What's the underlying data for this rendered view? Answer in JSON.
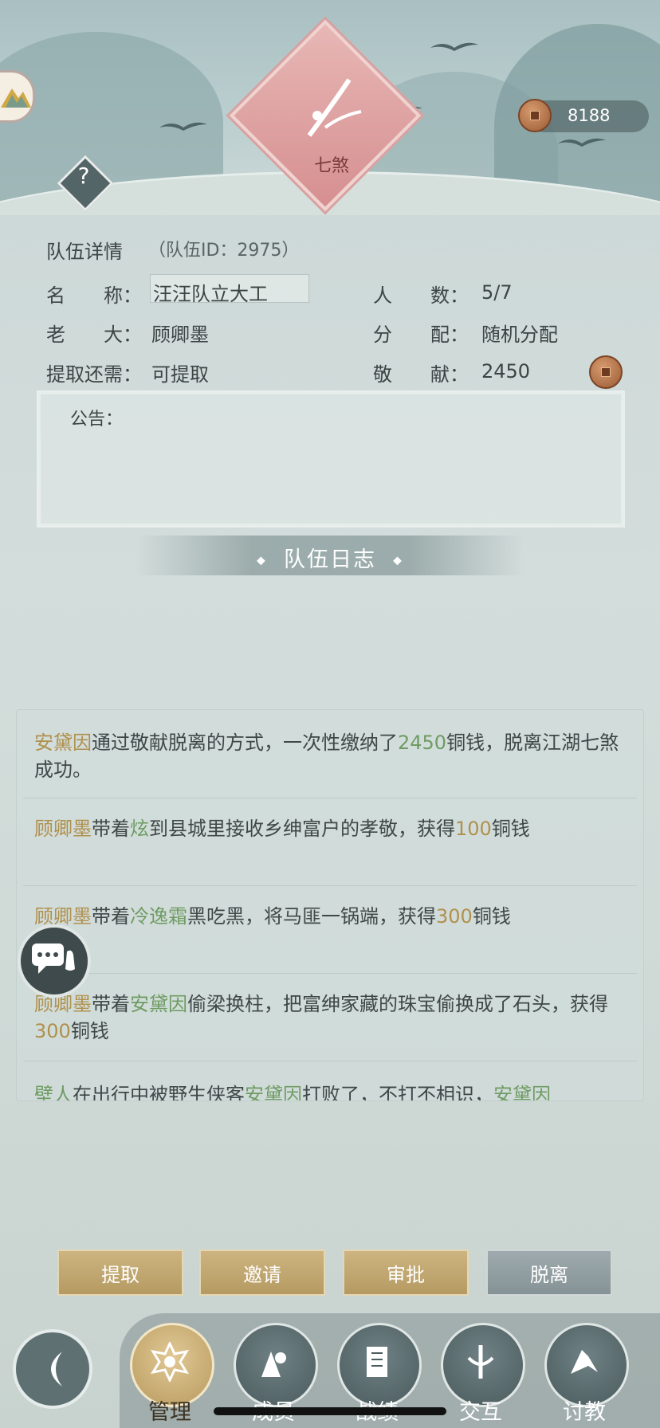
{
  "header": {
    "emblem_text": "七煞",
    "coins": "8188"
  },
  "team": {
    "title": "队伍详情",
    "id_label": "（队伍ID：2975）",
    "name_label": "名　　称：",
    "name_value": "汪汪队立大工",
    "members_label": "人　　数：",
    "members_value": "5/7",
    "leader_label": "老　　大：",
    "leader_value": "顾卿墨",
    "distribution_label": "分　　配：",
    "distribution_value": "随机分配",
    "withdraw_label": "提取还需：",
    "withdraw_value": "可提取",
    "contribution_label": "敬　　献：",
    "contribution_value": "2450",
    "notice_label": "公告："
  },
  "log": {
    "title": "队伍日志",
    "entries": [
      {
        "a": "安黛因",
        "b": "通过敬献脱离的方式，一次性缴纳了",
        "c": "2450",
        "d": "铜钱，脱离江湖七煞成功。"
      },
      {
        "a": "顾卿墨",
        "b": "带着",
        "c": "炫",
        "d": "到县城里接收乡绅富户的孝敬，获得",
        "e": "100",
        "f": "铜钱"
      },
      {
        "a": "顾卿墨",
        "b": "带着",
        "c": "冷逸霜",
        "d": "黑吃黑，将马匪一锅端，获得",
        "e": "300",
        "f": "铜钱"
      },
      {
        "a": "顾卿墨",
        "b": "带着",
        "c": "安黛因",
        "d": "偷梁换柱，把富绅家藏的珠宝偷换成了石头，获得",
        "e": "300",
        "f": "铜钱"
      },
      {
        "a": "壁人",
        "b": "在出行中被野生侠客",
        "c": "安黛因",
        "d": "打败了，不打不相识，",
        "e": "安黛因"
      }
    ]
  },
  "actions": {
    "withdraw": "提取",
    "invite": "邀请",
    "approve": "审批",
    "leave": "脱离"
  },
  "nav": {
    "manage": "管理",
    "members": "成员",
    "records": "战绩",
    "interact": "交互",
    "teach": "讨教"
  },
  "colors": {
    "gold_name": "#b0904d",
    "green_name": "#6f9b63",
    "button_gold": "#c4aa72",
    "button_gray": "#8f9c9f"
  },
  "icons": {
    "emblem": "sword-emblem-icon",
    "coin": "copper-coin-icon",
    "help": "question-icon",
    "chat": "chat-bubble-icon",
    "back": "back-arrow-icon"
  }
}
